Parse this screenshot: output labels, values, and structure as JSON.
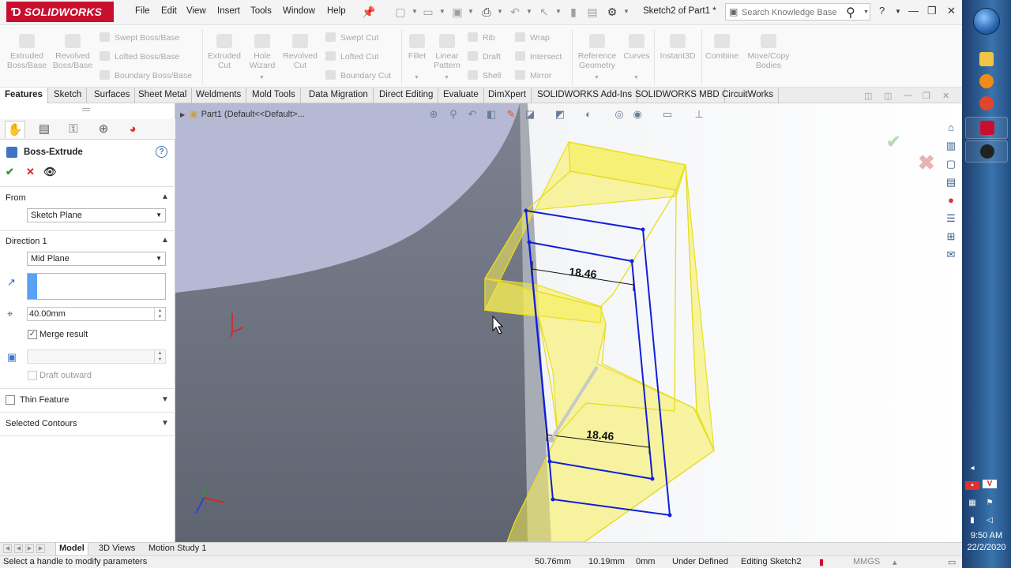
{
  "app": {
    "logo": "SOLIDWORKS",
    "doc_title": "Sketch2 of Part1 *"
  },
  "menu": [
    "File",
    "Edit",
    "View",
    "Insert",
    "Tools",
    "Window",
    "Help"
  ],
  "search": {
    "placeholder": "Search Knowledge Base",
    "value": ""
  },
  "command_manager": {
    "big": [
      {
        "label": "Extruded\nBoss/Base"
      },
      {
        "label": "Revolved\nBoss/Base"
      },
      {
        "label": "Extruded\nCut"
      },
      {
        "label": "Hole\nWizard"
      },
      {
        "label": "Revolved\nCut"
      },
      {
        "label": "Fillet"
      },
      {
        "label": "Linear\nPattern"
      },
      {
        "label": "Reference\nGeometry"
      },
      {
        "label": "Curves"
      },
      {
        "label": "Instant3D"
      },
      {
        "label": "Combine"
      },
      {
        "label": "Move/Copy\nBodies"
      }
    ],
    "small": [
      "Swept Boss/Base",
      "Lofted Boss/Base",
      "Boundary Boss/Base",
      "Swept Cut",
      "Lofted Cut",
      "Boundary Cut",
      "Rib",
      "Draft",
      "Shell",
      "Wrap",
      "Intersect",
      "Mirror"
    ]
  },
  "tabs": [
    "Features",
    "Sketch",
    "Surfaces",
    "Sheet Metal",
    "Weldments",
    "Mold Tools",
    "Data Migration",
    "Direct Editing",
    "Evaluate",
    "DimXpert",
    "SOLIDWORKS Add-Ins",
    "SOLIDWORKS MBD",
    "CircuitWorks"
  ],
  "property_manager": {
    "title": "Boss-Extrude",
    "help": "?",
    "from_label": "From",
    "from_value": "Sketch Plane",
    "direction_label": "Direction 1",
    "direction_value": "Mid Plane",
    "depth_value": "40.00mm",
    "merge_label": "Merge result",
    "merge_checked": true,
    "draft_label": "Draft outward",
    "thin_label": "Thin Feature",
    "contours_label": "Selected Contours"
  },
  "graphics": {
    "breadcrumb": "Part1  (Default<<Default>...",
    "dim_top": "18.46",
    "dim_bottom": "18.46"
  },
  "bottom_tabs": [
    "Model",
    "3D Views",
    "Motion Study 1"
  ],
  "status": {
    "hint": "Select a handle to modify parameters",
    "x": "50.76mm",
    "y": "10.19mm",
    "z": "0mm",
    "state": "Under Defined",
    "editing": "Editing Sketch2",
    "units": "MMGS"
  },
  "clock": {
    "time": "9:50 AM",
    "date": "22/2/2020"
  },
  "colors": {
    "accent": "#c8102e",
    "sketch_blue": "#1020d8",
    "preview_yellow": "#f7ee55"
  }
}
